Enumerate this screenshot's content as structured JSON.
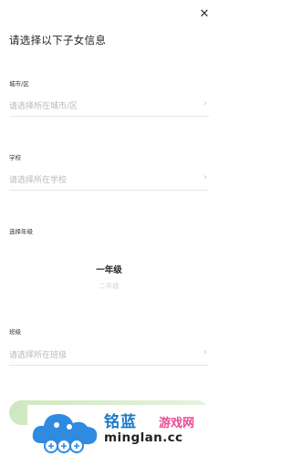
{
  "header": {
    "close_glyph": "✕",
    "title": "请选择以下子女信息"
  },
  "city": {
    "label": "城市/区",
    "placeholder": "请选择所在城市/区"
  },
  "school": {
    "label": "学校",
    "placeholder": "请选择所在学校"
  },
  "grade": {
    "label": "选择年级",
    "selected": "一年级",
    "next": "二年级"
  },
  "class_field": {
    "label": "班级",
    "placeholder": "请选择所在班级"
  },
  "chevron_glyph": "›",
  "colors": {
    "button_gradient_start": "#cfe8c0",
    "button_gradient_end": "#e6f2dc",
    "placeholder": "#b8b8b8"
  },
  "watermark": {
    "brand": "铭蓝",
    "sub": "游戏网",
    "url": "minglan.cc"
  }
}
